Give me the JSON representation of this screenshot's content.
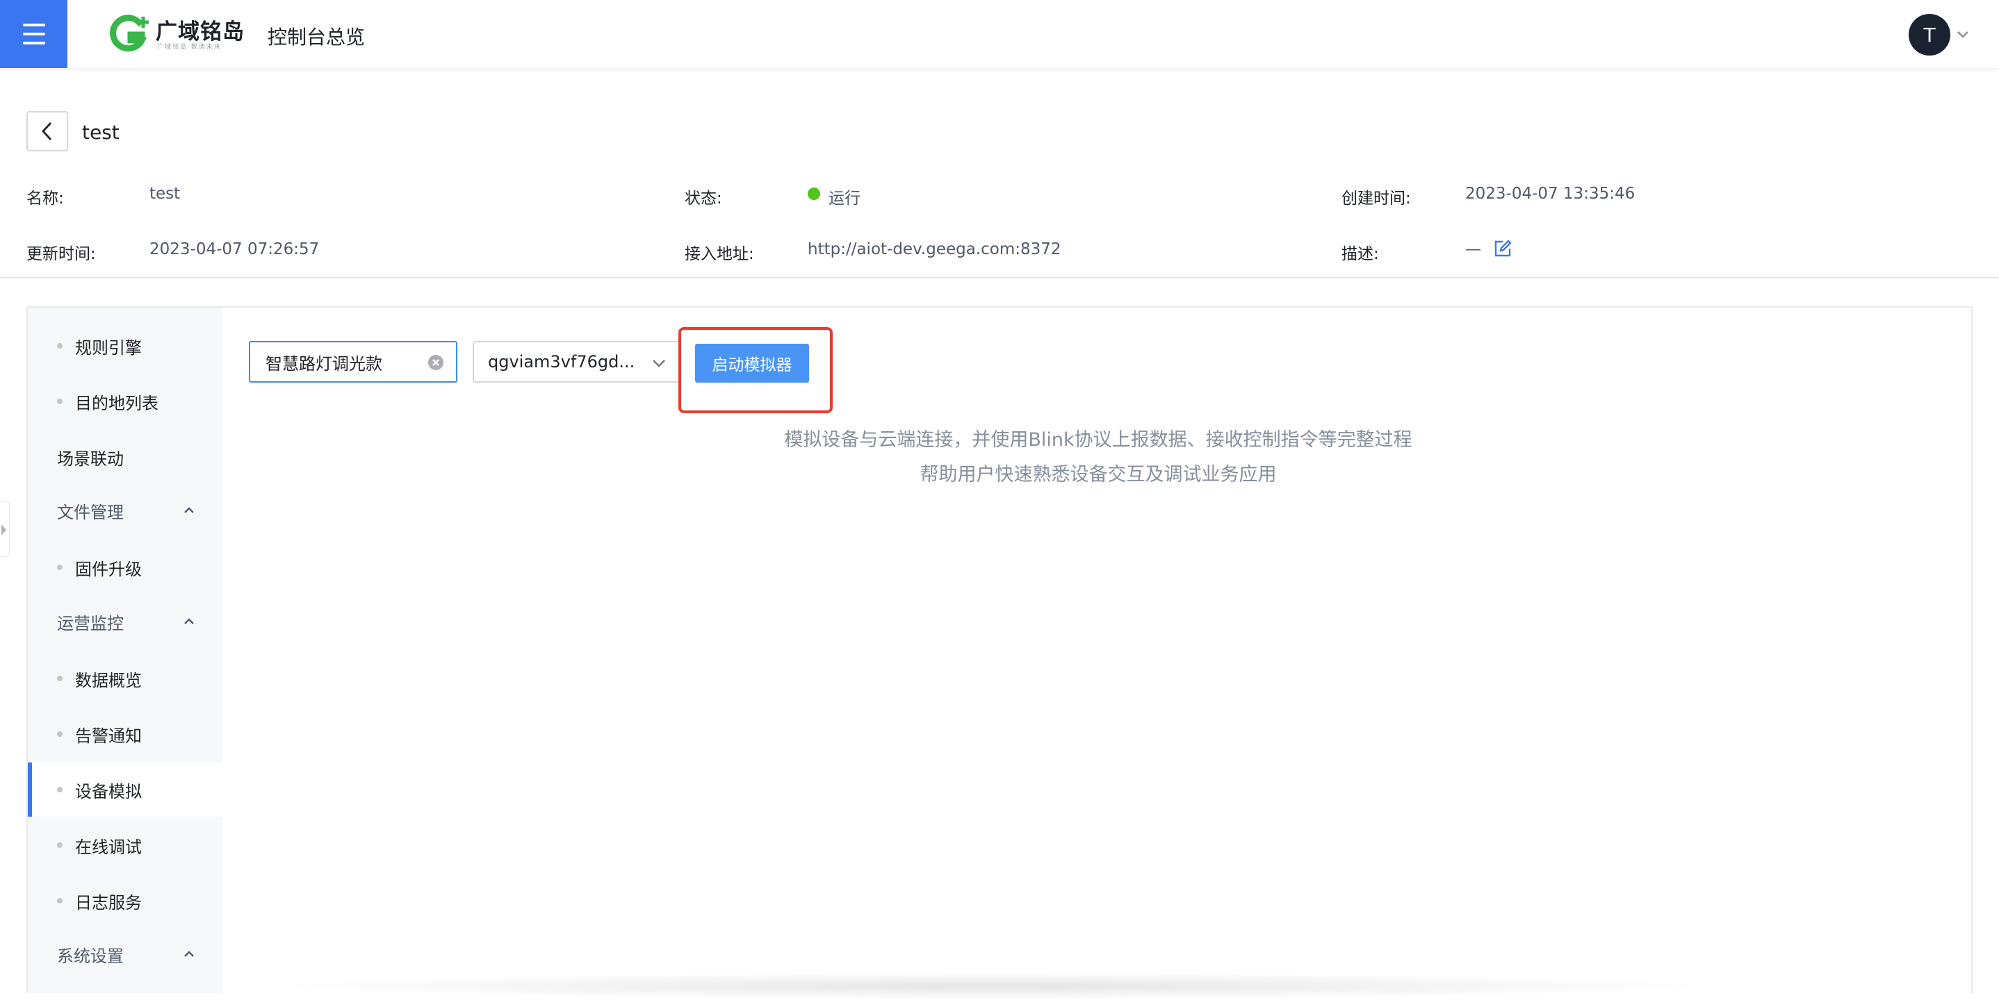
{
  "header": {
    "brand_title": "广域铭岛",
    "brand_subtitle": "广域铭岛 数造未来",
    "console_title": "控制台总览",
    "avatar_initial": "T",
    "brand_color": "#3a76f0"
  },
  "page": {
    "title": "test"
  },
  "details": {
    "name_label": "名称:",
    "name_value": "test",
    "status_label": "状态:",
    "status_value": "运行",
    "status_color": "#52c41a",
    "created_label": "创建时间:",
    "created_value": "2023-04-07 13:35:46",
    "updated_label": "更新时间:",
    "updated_value": "2023-04-07 07:26:57",
    "endpoint_label": "接入地址:",
    "endpoint_value": "http://aiot-dev.geega.com:8372",
    "desc_label": "描述:",
    "desc_value": "—"
  },
  "sidebar": {
    "items": [
      {
        "label": "规则引擎",
        "type": "sub"
      },
      {
        "label": "目的地列表",
        "type": "sub"
      },
      {
        "label": "场景联动",
        "type": "plain"
      },
      {
        "label": "文件管理",
        "type": "group"
      },
      {
        "label": "固件升级",
        "type": "sub"
      },
      {
        "label": "运营监控",
        "type": "group"
      },
      {
        "label": "数据概览",
        "type": "sub"
      },
      {
        "label": "告警通知",
        "type": "sub"
      },
      {
        "label": "设备模拟",
        "type": "sub",
        "active": true
      },
      {
        "label": "在线调试",
        "type": "sub"
      },
      {
        "label": "日志服务",
        "type": "sub"
      },
      {
        "label": "系统设置",
        "type": "group"
      }
    ]
  },
  "simulator": {
    "product_value": "智慧路灯调光款",
    "device_value": "qgviam3vf76gd...",
    "start_button": "启动模拟器",
    "description_line1": "模拟设备与云端连接，并使用Blink协议上报数据、接收控制指令等完整过程",
    "description_line2": "帮助用户快速熟悉设备交互及调试业务应用",
    "highlight_color": "#e53d2f"
  }
}
